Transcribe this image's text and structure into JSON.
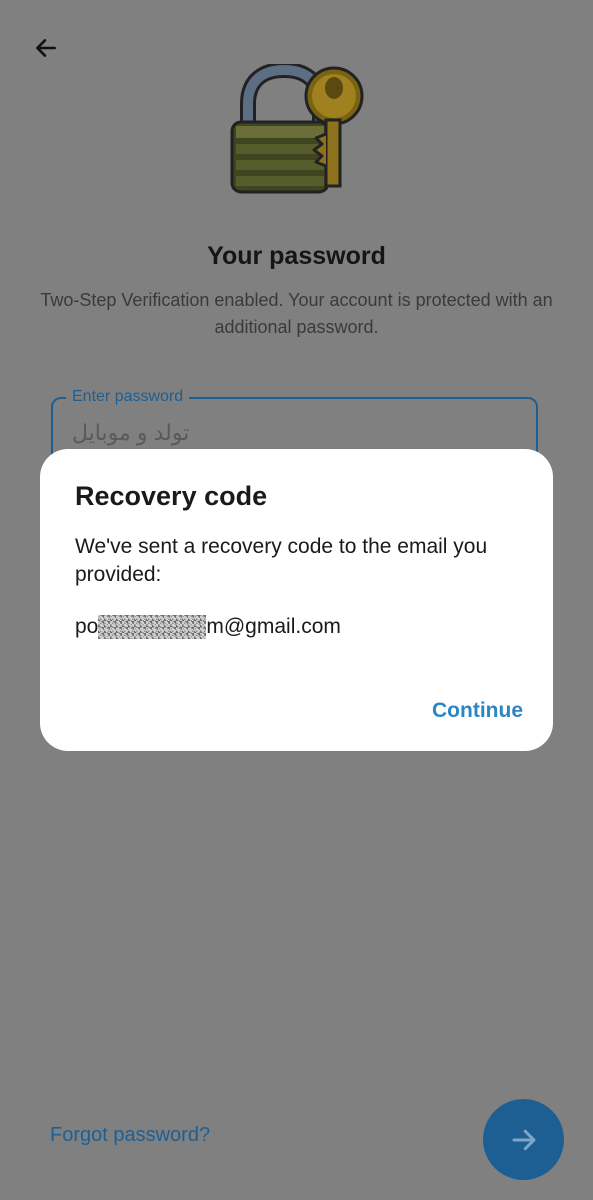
{
  "header": {
    "back_icon": "arrow-left-icon",
    "illustration": "padlock-with-key"
  },
  "main": {
    "title": "Your password",
    "subtitle": "Two-Step Verification enabled. Your account is protected with an additional password.",
    "password_field": {
      "label": "Enter password",
      "value": "تولد و موبایل"
    },
    "forgot_password_label": "Forgot password?",
    "next_icon": "arrow-right-icon"
  },
  "dialog": {
    "title": "Recovery code",
    "message": "We've sent a recovery code to the email you provided:",
    "email_prefix": "po",
    "email_suffix": "m@gmail.com",
    "continue_label": "Continue"
  },
  "colors": {
    "scrim_background": "#808080",
    "accent": "#2b86c5",
    "accent_dimmed": "#1e5f93",
    "dialog_background": "#ffffff"
  }
}
